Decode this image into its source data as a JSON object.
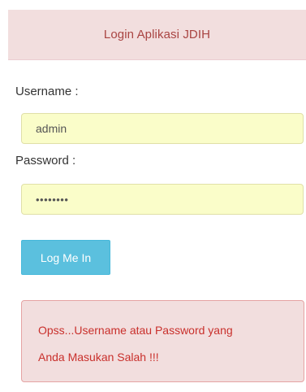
{
  "header": {
    "title": "Login Aplikasi JDIH"
  },
  "form": {
    "username_label": "Username :",
    "username_value": "admin",
    "password_label": "Password :",
    "password_masked": "••••••••",
    "submit_label": "Log Me In"
  },
  "alert": {
    "line1": "Opss...Username atau Password yang",
    "line2": "Anda Masukan Salah !!!"
  },
  "colors": {
    "header_bg": "#f2dede",
    "header_text": "#a94442",
    "input_bg": "#fafdc9",
    "button_bg": "#5bc0de",
    "alert_text": "#c9302c"
  }
}
